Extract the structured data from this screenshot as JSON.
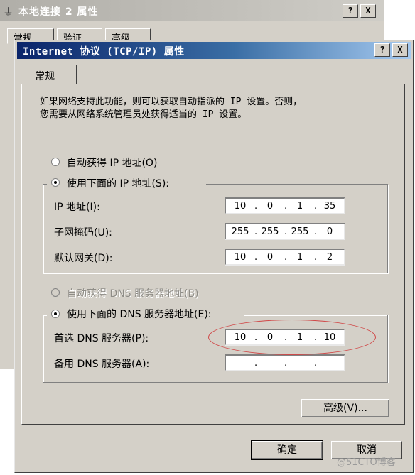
{
  "background_dialog": {
    "title": "本地连接 2 属性",
    "help_button": "?",
    "close_button": "X",
    "tabs": [
      "常规",
      "验证",
      "高级"
    ]
  },
  "dialog": {
    "title": "Internet 协议 (TCP/IP) 属性",
    "help_button": "?",
    "close_button": "X",
    "tab_general": "常规",
    "description_line1": "如果网络支持此功能，则可以获取自动指派的 IP 设置。否则，",
    "description_line2": "您需要从网络系统管理员处获得适当的 IP 设置。",
    "ip_mode": {
      "auto_label": "自动获得 IP 地址(O)",
      "manual_label": "使用下面的 IP 地址(S):",
      "selected": "manual"
    },
    "ip_fields": [
      {
        "label": "IP 地址(I):",
        "octets": [
          "10",
          "0",
          "1",
          "35"
        ]
      },
      {
        "label": "子网掩码(U):",
        "octets": [
          "255",
          "255",
          "255",
          "0"
        ]
      },
      {
        "label": "默认网关(D):",
        "octets": [
          "10",
          "0",
          "1",
          "2"
        ]
      }
    ],
    "dns_mode": {
      "auto_label": "自动获得 DNS 服务器地址(B)",
      "manual_label": "使用下面的 DNS 服务器地址(E):",
      "selected": "manual",
      "auto_enabled": false
    },
    "dns_fields": [
      {
        "label": "首选 DNS 服务器(P):",
        "octets": [
          "10",
          "0",
          "1",
          "10"
        ]
      },
      {
        "label": "备用 DNS 服务器(A):",
        "octets": [
          "",
          "",
          "",
          ""
        ]
      }
    ],
    "advanced_button": "高级(V)...",
    "ok_button": "确定",
    "cancel_button": "取消"
  },
  "watermark": "@51CTO博客",
  "colors": {
    "dialog_face": "#d4d0c8",
    "active_title_start": "#0a246a",
    "active_title_end": "#a6caf0",
    "inactive_title": "#b0aea8",
    "highlight_ellipse": "#d04848"
  }
}
